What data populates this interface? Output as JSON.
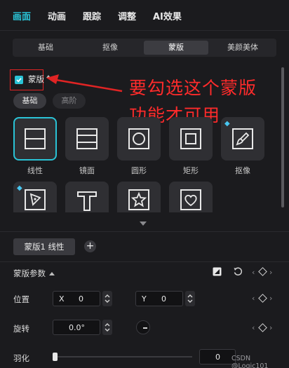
{
  "top_tabs": [
    "画面",
    "动画",
    "跟踪",
    "调整",
    "AI效果"
  ],
  "sub_tabs": [
    "基础",
    "抠像",
    "蒙版",
    "美颜美体"
  ],
  "mask_section": {
    "checkbox_label": "蒙版",
    "checked": true
  },
  "annotation": {
    "line1": "要勾选这个蒙版",
    "line2": "功能才可用"
  },
  "mode_pills": [
    "基础",
    "高阶"
  ],
  "shapes": [
    {
      "label": "线性",
      "icon": "linear-mask-icon",
      "selected": true
    },
    {
      "label": "镜面",
      "icon": "mirror-mask-icon"
    },
    {
      "label": "圆形",
      "icon": "circle-mask-icon"
    },
    {
      "label": "矩形",
      "icon": "rectangle-mask-icon"
    },
    {
      "label": "抠像",
      "icon": "brush-mask-icon",
      "premium": true
    },
    {
      "label": "",
      "icon": "pen-mask-icon",
      "premium": true
    },
    {
      "label": "",
      "icon": "text-mask-icon"
    },
    {
      "label": "",
      "icon": "star-mask-icon"
    },
    {
      "label": "",
      "icon": "heart-mask-icon"
    }
  ],
  "layer_tag": "蒙版1 线性",
  "params": {
    "title": "蒙版参数",
    "position_label": "位置",
    "x_axis": "X",
    "x_value": "0",
    "y_axis": "Y",
    "y_value": "0",
    "rotate_label": "旋转",
    "rotate_value": "0.0°",
    "feather_label": "羽化",
    "feather_value": "0"
  },
  "watermark": "CSDN @Logic101",
  "colors": {
    "accent": "#2ac3d6",
    "annotation": "#ff2b2b",
    "background": "#1b1b1e"
  }
}
